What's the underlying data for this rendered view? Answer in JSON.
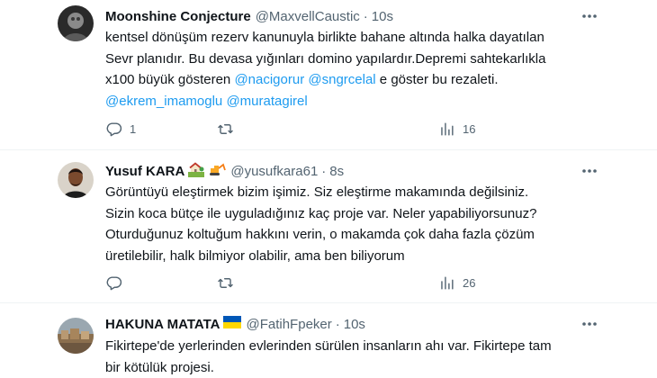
{
  "tweets": [
    {
      "name": "Moonshine Conjecture",
      "handle": "@MaxvellCaustic",
      "dot": "·",
      "time": "10s",
      "lines": [
        "kentsel dönüşüm rezerv kanunuyla birlikte bahane altında halka dayatılan",
        "Sevr planıdır. Bu devasa yığınları domino yapılardır.Depremi sahtekarlıkla"
      ],
      "line3_pre": "x100 büyük gösteren ",
      "line3_m1": "@nacigorur",
      "line3_m2": "@sngrcelal",
      "line3_post": " e göster bu rezaleti.",
      "line4_m1": "@ekrem_imamoglu",
      "line4_m2": "@muratagirel",
      "reply_count": "1",
      "retweet_count": "",
      "views_count": "16"
    },
    {
      "name": "Yusuf KARA",
      "emoji_icons": [
        "house-with-garden-icon",
        "excavator-icon"
      ],
      "handle": "@yusufkara61",
      "dot": "·",
      "time": "8s",
      "lines": [
        "Görüntüyü eleştirmek bizim işimiz. Siz eleştirme makamında değilsiniz.",
        "Sizin koca bütçe ile uyguladığınız kaç proje var. Neler yapabiliyorsunuz?",
        "Oturduğunuz koltuğum hakkını verin, o makamda çok daha fazla çözüm",
        "üretilebilir, halk bilmiyor olabilir, ama ben biliyorum"
      ],
      "reply_count": "",
      "retweet_count": "",
      "views_count": "26"
    },
    {
      "name": "HAKUNA MATATA",
      "flag_icon": "ukraine-flag-icon",
      "handle": "@FatihFpeker",
      "dot": "·",
      "time": "10s",
      "lines": [
        "Fikirtepe'de yerlerinden evlerinden sürülen insanların ahı var. Fikirtepe tam",
        "bir kötülük projesi."
      ]
    }
  ],
  "colors": {
    "text": "#0f1419",
    "secondary": "#536471",
    "mention": "#1d9bf0",
    "divider": "#eff3f4"
  }
}
